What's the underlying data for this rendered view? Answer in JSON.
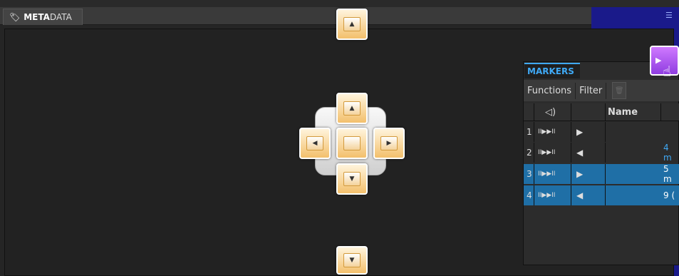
{
  "metadata_tab": {
    "prefix": "META",
    "suffix": "DATA"
  },
  "markers": {
    "tab_label": "MARKERS",
    "toolbar": {
      "functions": "Functions",
      "filter": "Filter"
    },
    "columns": {
      "speaker": "◁)",
      "name": "Name"
    },
    "rows": [
      {
        "index": "1",
        "transport": "II▶▶II",
        "direction": "▶",
        "value": "",
        "selected": false
      },
      {
        "index": "2",
        "transport": "II▶▶II",
        "direction": "◀",
        "value": "4 m",
        "selected": false
      },
      {
        "index": "3",
        "transport": "II▶▶II",
        "direction": "▶",
        "value": "5 m",
        "selected": true
      },
      {
        "index": "4",
        "transport": "II▶▶II",
        "direction": "◀",
        "value": "9 (",
        "selected": true
      }
    ]
  },
  "dock_arrows": {
    "up": "▲",
    "down": "▼",
    "left": "◀",
    "right": "▶"
  },
  "colors": {
    "accent_blue": "#1a1a8a",
    "selection": "#1f6fa6",
    "dock": "#f3c06c",
    "play": "#b35cf5"
  }
}
